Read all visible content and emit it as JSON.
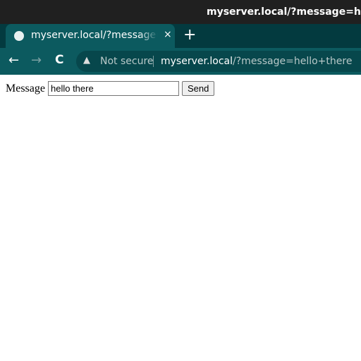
{
  "window": {
    "title": "myserver.local/?message=hello+there"
  },
  "tab": {
    "title": "myserver.local/?message=hello+there",
    "icon": "globe-icon",
    "close": "×"
  },
  "new_tab": "+",
  "toolbar": {
    "back": "←",
    "forward": "→",
    "reload": "C",
    "security": "Not secure",
    "url_host": "myserver.local",
    "url_rest": "/?message=hello+there",
    "warning_icon": "▲"
  },
  "form": {
    "label": "Message",
    "value": "hello there",
    "button": "Send"
  }
}
